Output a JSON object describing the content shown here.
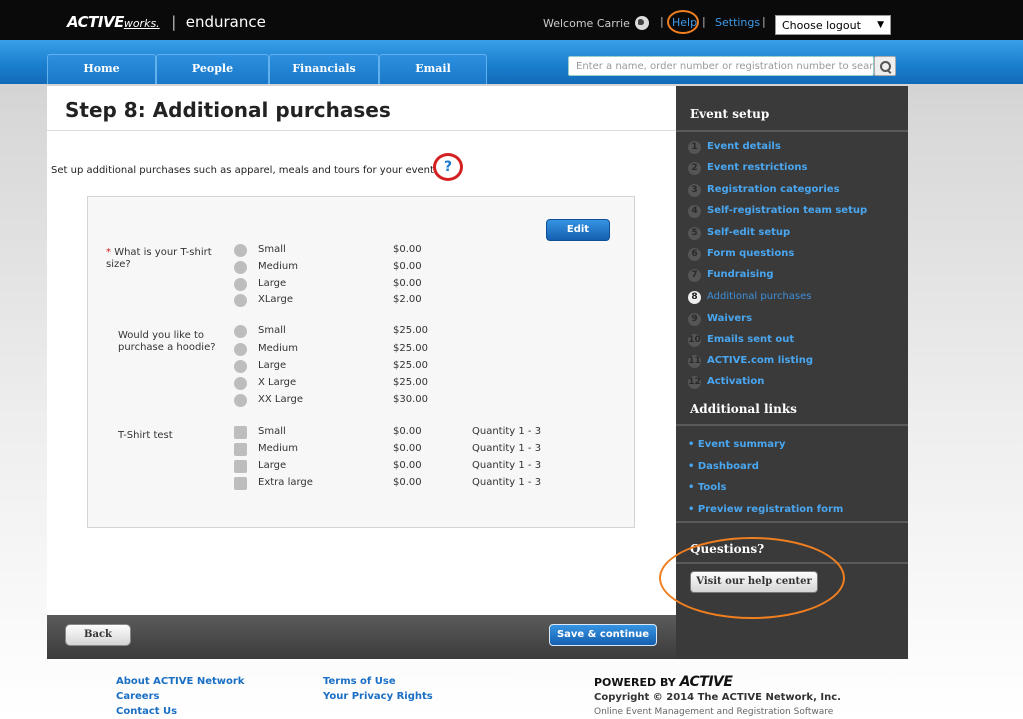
{
  "header": {
    "brand": "ACTIVE",
    "brand_suffix": "works.",
    "separator": "|",
    "product": "endurance",
    "welcome": "Welcome Carrie",
    "help": "Help",
    "settings": "Settings",
    "logout_selected": "Choose logout"
  },
  "nav": {
    "tabs": [
      {
        "label": "Home"
      },
      {
        "label": "People"
      },
      {
        "label": "Financials"
      },
      {
        "label": "Email"
      }
    ],
    "search_placeholder": "Enter a name, order number or registration number to search"
  },
  "main": {
    "title": "Step 8: Additional purchases",
    "intro": "Set up additional purchases such as apparel, meals and tours for your event",
    "help_mark": "?",
    "edit_label": "Edit",
    "questions": [
      {
        "label": "What is your T-shirt size?",
        "required": "*",
        "type": "radio",
        "options": [
          {
            "name": "Small",
            "price": "$0.00"
          },
          {
            "name": "Medium",
            "price": "$0.00"
          },
          {
            "name": "Large",
            "price": "$0.00"
          },
          {
            "name": "XLarge",
            "price": "$2.00"
          }
        ]
      },
      {
        "label": "Would you like to purchase a hoodie?",
        "type": "radio",
        "options": [
          {
            "name": "Small",
            "price": "$25.00"
          },
          {
            "name": "Medium",
            "price": "$25.00"
          },
          {
            "name": "Large",
            "price": "$25.00"
          },
          {
            "name": "X Large",
            "price": "$25.00"
          },
          {
            "name": "XX Large",
            "price": "$30.00"
          }
        ]
      },
      {
        "label": "T-Shirt test",
        "type": "checkbox",
        "options": [
          {
            "name": "Small",
            "price": "$0.00",
            "qty": "Quantity 1 - 3"
          },
          {
            "name": "Medium",
            "price": "$0.00",
            "qty": "Quantity 1 - 3"
          },
          {
            "name": "Large",
            "price": "$0.00",
            "qty": "Quantity 1 - 3"
          },
          {
            "name": "Extra large",
            "price": "$0.00",
            "qty": "Quantity 1 - 3"
          }
        ]
      }
    ],
    "back_label": "Back",
    "save_label": "Save & continue"
  },
  "sidebar": {
    "setup_title": "Event setup",
    "steps": [
      {
        "num": "1",
        "label": "Event details"
      },
      {
        "num": "2",
        "label": "Event restrictions"
      },
      {
        "num": "3",
        "label": "Registration categories"
      },
      {
        "num": "4",
        "label": "Self-registration team setup"
      },
      {
        "num": "5",
        "label": "Self-edit setup"
      },
      {
        "num": "6",
        "label": "Form questions"
      },
      {
        "num": "7",
        "label": "Fundraising"
      },
      {
        "num": "8",
        "label": "Additional purchases"
      },
      {
        "num": "9",
        "label": "Waivers"
      },
      {
        "num": "10",
        "label": "Emails sent out"
      },
      {
        "num": "11",
        "label": "ACTIVE.com listing"
      },
      {
        "num": "12",
        "label": "Activation"
      }
    ],
    "active_step": 8,
    "links_title": "Additional links",
    "links": [
      {
        "label": "Event summary"
      },
      {
        "label": "Dashboard"
      },
      {
        "label": "Tools"
      },
      {
        "label": "Preview registration form"
      }
    ],
    "questions_title": "Questions?",
    "help_button": "Visit our help center"
  },
  "footer": {
    "links_col1": [
      "About ACTIVE Network",
      "Careers",
      "Contact Us"
    ],
    "links_col2": [
      "Terms of Use",
      "Your Privacy Rights"
    ],
    "powered_by": "POWERED BY",
    "powered_logo": "ACTIVE",
    "copyright": "Copyright © 2014 The ACTIVE Network, Inc.",
    "tagline": "Online Event Management and Registration Software"
  },
  "colors": {
    "accent_blue": "#1b7fd0",
    "link_blue": "#49a6f0",
    "annotation_orange": "#f07f20",
    "annotation_red": "#d42020"
  }
}
